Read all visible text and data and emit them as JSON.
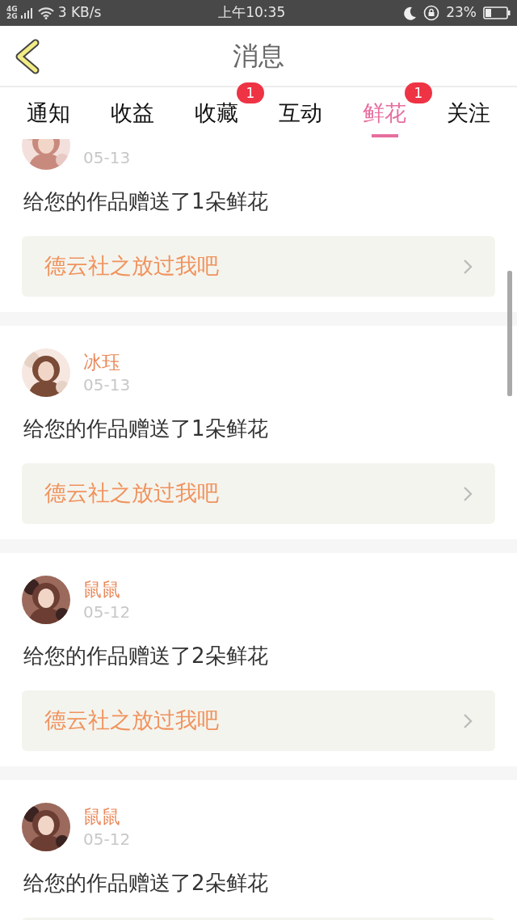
{
  "status_bar": {
    "network_top": "4G",
    "network_bottom": "2G",
    "speed": "3 KB/s",
    "time": "上午10:35",
    "battery": "23%"
  },
  "header": {
    "title": "消息"
  },
  "tabs": [
    {
      "label": "通知",
      "selected": false
    },
    {
      "label": "收益",
      "selected": false
    },
    {
      "label": "收藏",
      "selected": false,
      "badge": "1"
    },
    {
      "label": "互动",
      "selected": false
    },
    {
      "label": "鲜花",
      "selected": true,
      "badge": "1"
    },
    {
      "label": "关注",
      "selected": false
    }
  ],
  "messages": [
    {
      "date": "05-13",
      "text": "给您的作品赠送了1朵鲜花",
      "book": "德云社之放过我吧"
    },
    {
      "name": "冰珏",
      "date": "05-13",
      "text": "给您的作品赠送了1朵鲜花",
      "book": "德云社之放过我吧"
    },
    {
      "name": "鼠鼠",
      "date": "05-12",
      "text": "给您的作品赠送了2朵鲜花",
      "book": "德云社之放过我吧"
    },
    {
      "name": "鼠鼠",
      "date": "05-12",
      "text": "给您的作品赠送了2朵鲜花"
    }
  ]
}
